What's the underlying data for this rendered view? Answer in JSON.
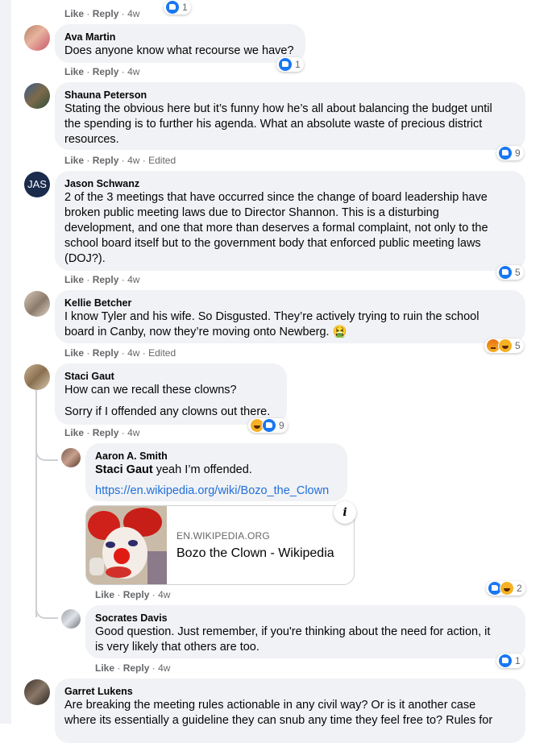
{
  "labels": {
    "like": "Like",
    "reply": "Reply",
    "sep": "·"
  },
  "top": {
    "time": "4w",
    "reactions": "1"
  },
  "comments": [
    {
      "name": "Ava Martin",
      "text": [
        "Does anyone know what recourse we have?"
      ],
      "time": "4w",
      "edited": "",
      "reactions": "1"
    },
    {
      "name": "Shauna Peterson",
      "text": [
        "Stating the obvious here but it’s funny how he’s all about balancing the budget until",
        "the spending is to further his agenda. What an absolute waste of precious district",
        "resources."
      ],
      "time": "4w",
      "edited": "Edited",
      "reactions": "9"
    },
    {
      "name": "Jason Schwanz",
      "avatar_text": "JAS",
      "text": [
        "2 of the 3 meetings that have occurred since the change of board leadership have",
        "broken public meeting laws due to Director Shannon. This is a disturbing",
        "development, and one that more than deserves a formal complaint, not only to the",
        "school board itself but to the government body that enforced public meeting laws",
        "(DOJ?)."
      ],
      "time": "4w",
      "edited": "",
      "reactions": "5"
    },
    {
      "name": "Kellie Betcher",
      "text": [
        "I know Tyler and his wife. So Disgusted. They’re actively trying to ruin the school",
        "board in Canby, now they’re moving onto Newberg. 🤮"
      ],
      "time": "4w",
      "edited": "Edited",
      "reactions": "5"
    },
    {
      "name": "Staci Gaut",
      "text": [
        "How can we recall these clowns?",
        "Sorry if I offended any clowns out there."
      ],
      "time": "4w",
      "edited": "",
      "reactions": "9"
    }
  ],
  "replies": [
    {
      "name": "Aaron A. Smith",
      "mention": "Staci Gaut",
      "text": " yeah I’m offended.",
      "link": "https://en.wikipedia.org/wiki/Bozo_the_Clown",
      "time": "4w",
      "reactions": "2"
    },
    {
      "name": "Socrates Davis",
      "text": [
        "Good question. Just remember, if you're thinking about the need for action, it",
        "is very likely that others are too."
      ],
      "time": "4w",
      "reactions": "1"
    }
  ],
  "link_card": {
    "domain": "EN.WIKIPEDIA.ORG",
    "title": "Bozo the Clown - Wikipedia",
    "info_icon": "i"
  },
  "last": {
    "name": "Garret Lukens",
    "text": [
      "Are breaking the meeting rules actionable in any civil way? Or is it another case",
      "where its essentially a guideline they can snub any time they feel free to? Rules for"
    ]
  },
  "colors": {
    "bubble": "#f0f2f5",
    "link": "#216fdb",
    "like": "#1877f2",
    "meta": "#65676b"
  },
  "icons": [
    "like-reaction-icon",
    "haha-reaction-icon",
    "angry-reaction-icon",
    "info-icon",
    "nauseated-emoji"
  ]
}
